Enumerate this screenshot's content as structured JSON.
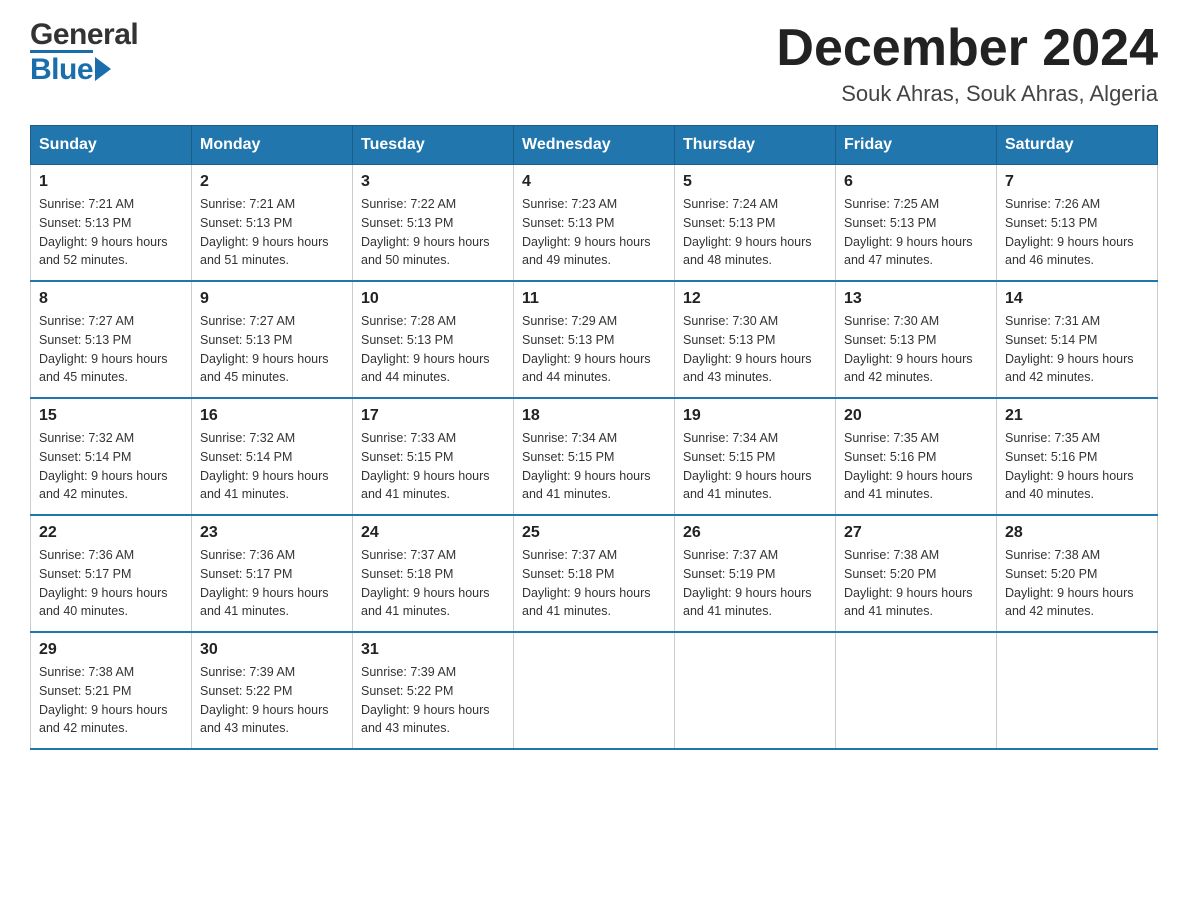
{
  "header": {
    "logo_general": "General",
    "logo_blue": "Blue",
    "title": "December 2024",
    "location": "Souk Ahras, Souk Ahras, Algeria"
  },
  "calendar": {
    "days_of_week": [
      "Sunday",
      "Monday",
      "Tuesday",
      "Wednesday",
      "Thursday",
      "Friday",
      "Saturday"
    ],
    "weeks": [
      [
        {
          "day": "1",
          "sunrise": "7:21 AM",
          "sunset": "5:13 PM",
          "daylight": "9 hours and 52 minutes."
        },
        {
          "day": "2",
          "sunrise": "7:21 AM",
          "sunset": "5:13 PM",
          "daylight": "9 hours and 51 minutes."
        },
        {
          "day": "3",
          "sunrise": "7:22 AM",
          "sunset": "5:13 PM",
          "daylight": "9 hours and 50 minutes."
        },
        {
          "day": "4",
          "sunrise": "7:23 AM",
          "sunset": "5:13 PM",
          "daylight": "9 hours and 49 minutes."
        },
        {
          "day": "5",
          "sunrise": "7:24 AM",
          "sunset": "5:13 PM",
          "daylight": "9 hours and 48 minutes."
        },
        {
          "day": "6",
          "sunrise": "7:25 AM",
          "sunset": "5:13 PM",
          "daylight": "9 hours and 47 minutes."
        },
        {
          "day": "7",
          "sunrise": "7:26 AM",
          "sunset": "5:13 PM",
          "daylight": "9 hours and 46 minutes."
        }
      ],
      [
        {
          "day": "8",
          "sunrise": "7:27 AM",
          "sunset": "5:13 PM",
          "daylight": "9 hours and 45 minutes."
        },
        {
          "day": "9",
          "sunrise": "7:27 AM",
          "sunset": "5:13 PM",
          "daylight": "9 hours and 45 minutes."
        },
        {
          "day": "10",
          "sunrise": "7:28 AM",
          "sunset": "5:13 PM",
          "daylight": "9 hours and 44 minutes."
        },
        {
          "day": "11",
          "sunrise": "7:29 AM",
          "sunset": "5:13 PM",
          "daylight": "9 hours and 44 minutes."
        },
        {
          "day": "12",
          "sunrise": "7:30 AM",
          "sunset": "5:13 PM",
          "daylight": "9 hours and 43 minutes."
        },
        {
          "day": "13",
          "sunrise": "7:30 AM",
          "sunset": "5:13 PM",
          "daylight": "9 hours and 42 minutes."
        },
        {
          "day": "14",
          "sunrise": "7:31 AM",
          "sunset": "5:14 PM",
          "daylight": "9 hours and 42 minutes."
        }
      ],
      [
        {
          "day": "15",
          "sunrise": "7:32 AM",
          "sunset": "5:14 PM",
          "daylight": "9 hours and 42 minutes."
        },
        {
          "day": "16",
          "sunrise": "7:32 AM",
          "sunset": "5:14 PM",
          "daylight": "9 hours and 41 minutes."
        },
        {
          "day": "17",
          "sunrise": "7:33 AM",
          "sunset": "5:15 PM",
          "daylight": "9 hours and 41 minutes."
        },
        {
          "day": "18",
          "sunrise": "7:34 AM",
          "sunset": "5:15 PM",
          "daylight": "9 hours and 41 minutes."
        },
        {
          "day": "19",
          "sunrise": "7:34 AM",
          "sunset": "5:15 PM",
          "daylight": "9 hours and 41 minutes."
        },
        {
          "day": "20",
          "sunrise": "7:35 AM",
          "sunset": "5:16 PM",
          "daylight": "9 hours and 41 minutes."
        },
        {
          "day": "21",
          "sunrise": "7:35 AM",
          "sunset": "5:16 PM",
          "daylight": "9 hours and 40 minutes."
        }
      ],
      [
        {
          "day": "22",
          "sunrise": "7:36 AM",
          "sunset": "5:17 PM",
          "daylight": "9 hours and 40 minutes."
        },
        {
          "day": "23",
          "sunrise": "7:36 AM",
          "sunset": "5:17 PM",
          "daylight": "9 hours and 41 minutes."
        },
        {
          "day": "24",
          "sunrise": "7:37 AM",
          "sunset": "5:18 PM",
          "daylight": "9 hours and 41 minutes."
        },
        {
          "day": "25",
          "sunrise": "7:37 AM",
          "sunset": "5:18 PM",
          "daylight": "9 hours and 41 minutes."
        },
        {
          "day": "26",
          "sunrise": "7:37 AM",
          "sunset": "5:19 PM",
          "daylight": "9 hours and 41 minutes."
        },
        {
          "day": "27",
          "sunrise": "7:38 AM",
          "sunset": "5:20 PM",
          "daylight": "9 hours and 41 minutes."
        },
        {
          "day": "28",
          "sunrise": "7:38 AM",
          "sunset": "5:20 PM",
          "daylight": "9 hours and 42 minutes."
        }
      ],
      [
        {
          "day": "29",
          "sunrise": "7:38 AM",
          "sunset": "5:21 PM",
          "daylight": "9 hours and 42 minutes."
        },
        {
          "day": "30",
          "sunrise": "7:39 AM",
          "sunset": "5:22 PM",
          "daylight": "9 hours and 43 minutes."
        },
        {
          "day": "31",
          "sunrise": "7:39 AM",
          "sunset": "5:22 PM",
          "daylight": "9 hours and 43 minutes."
        },
        {
          "day": "",
          "sunrise": "",
          "sunset": "",
          "daylight": ""
        },
        {
          "day": "",
          "sunrise": "",
          "sunset": "",
          "daylight": ""
        },
        {
          "day": "",
          "sunrise": "",
          "sunset": "",
          "daylight": ""
        },
        {
          "day": "",
          "sunrise": "",
          "sunset": "",
          "daylight": ""
        }
      ]
    ],
    "labels": {
      "sunrise": "Sunrise: ",
      "sunset": "Sunset: ",
      "daylight": "Daylight: "
    }
  }
}
